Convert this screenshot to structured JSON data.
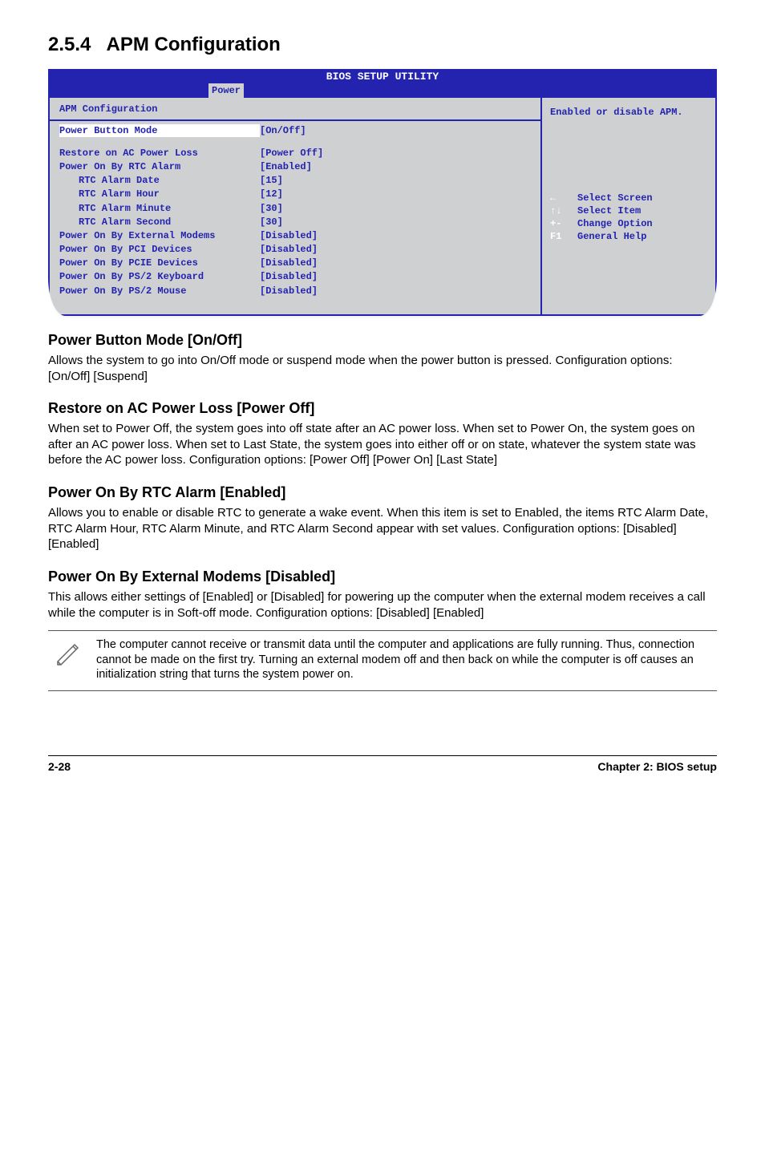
{
  "section": {
    "number": "2.5.4",
    "title": "APM Configuration"
  },
  "bios": {
    "title": "BIOS SETUP UTILITY",
    "tab": "Power",
    "heading": "APM Configuration",
    "rows": [
      {
        "label": "Power Button Mode",
        "value": "[On/Off]",
        "selected": true
      },
      {
        "label": "Restore on AC Power Loss",
        "value": "[Power Off]"
      },
      {
        "label": "Power On By RTC Alarm",
        "value": "[Enabled]"
      },
      {
        "label": "RTC Alarm Date",
        "value": "[15]",
        "indent": true
      },
      {
        "label": "RTC Alarm Hour",
        "value": "[12]",
        "indent": true
      },
      {
        "label": "RTC Alarm Minute",
        "value": "[30]",
        "indent": true
      },
      {
        "label": "RTC Alarm Second",
        "value": "[30]",
        "indent": true
      },
      {
        "label": "Power On By External Modems",
        "value": "[Disabled]"
      },
      {
        "label": "Power On By PCI Devices",
        "value": "[Disabled]"
      },
      {
        "label": "Power On By PCIE Devices",
        "value": "[Disabled]"
      },
      {
        "label": "Power On By PS/2 Keyboard",
        "value": "[Disabled]"
      },
      {
        "label": "Power On By PS/2 Mouse",
        "value": "[Disabled]"
      }
    ],
    "help": "Enabled or disable APM.",
    "keys": [
      {
        "k": "←",
        "d": "Select Screen"
      },
      {
        "k": "↑↓",
        "d": "Select Item"
      },
      {
        "k": "+-",
        "d": "Change Option"
      },
      {
        "k": "F1",
        "d": "General Help"
      }
    ]
  },
  "sections": {
    "s1": {
      "h": "Power Button Mode [On/Off]",
      "p": "Allows the system to go into On/Off mode or suspend mode when the power button is pressed. Configuration options: [On/Off] [Suspend]"
    },
    "s2": {
      "h": "Restore on AC Power Loss [Power Off]",
      "p": "When set to Power Off, the system goes into off state after an AC power loss. When set to Power On, the system goes on after an AC power loss. When set to Last State, the system goes into either off or on state, whatever the system state was before the AC power loss. Configuration options: [Power Off] [Power On] [Last State]"
    },
    "s3": {
      "h": "Power On By RTC Alarm [Enabled]",
      "p": "Allows you to enable or disable RTC to generate a wake event. When this item is set to Enabled, the items RTC Alarm Date, RTC Alarm Hour, RTC Alarm Minute, and RTC Alarm Second appear with set values. Configuration options: [Disabled] [Enabled]"
    },
    "s4": {
      "h": "Power On By External Modems [Disabled]",
      "p": "This allows either settings of [Enabled] or [Disabled] for powering up the computer when the external modem receives a call while the computer is in Soft-off mode. Configuration options: [Disabled] [Enabled]"
    }
  },
  "note": "The computer cannot receive or transmit data until the computer and applications are fully running. Thus, connection cannot be made on the first try. Turning an external modem off and then back on while the computer is off causes an initialization string that turns the system power on.",
  "footer": {
    "left": "2-28",
    "right": "Chapter 2: BIOS setup"
  }
}
